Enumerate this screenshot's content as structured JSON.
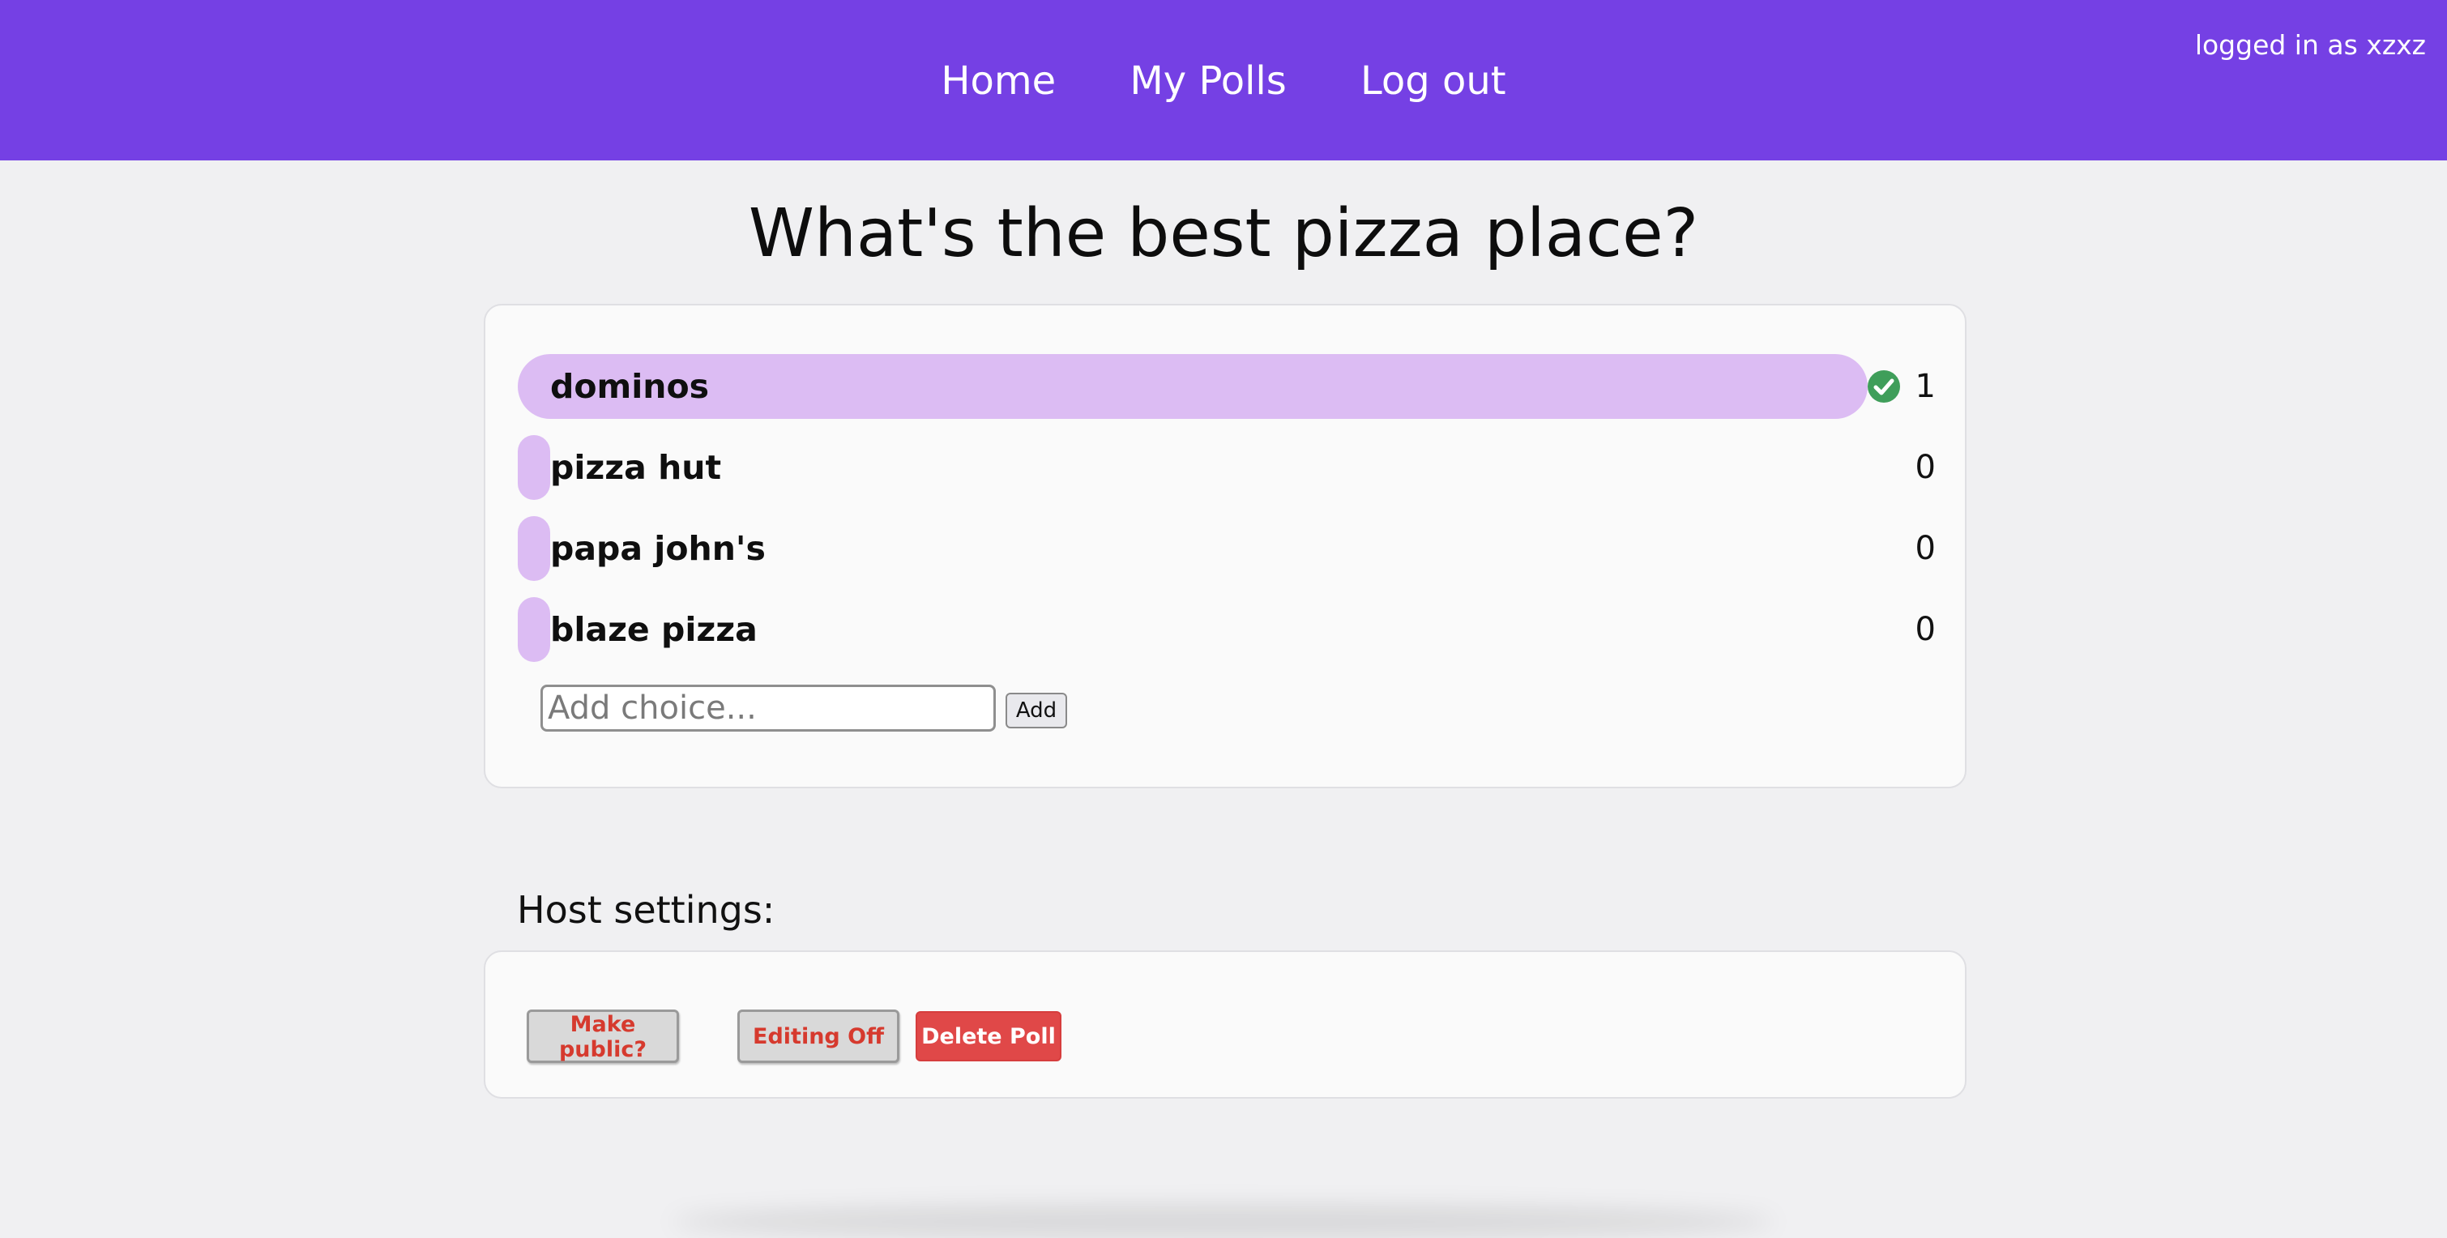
{
  "header": {
    "nav": [
      {
        "label": "Home"
      },
      {
        "label": "My Polls"
      },
      {
        "label": "Log out"
      }
    ],
    "user_status": "logged in as xzxz",
    "bg_color": "#7540e4"
  },
  "poll": {
    "title": "What's the best pizza place?",
    "choices": [
      {
        "label": "dominos",
        "votes": "1",
        "share": 1.0,
        "voted": true,
        "icon": "check-circle-icon"
      },
      {
        "label": "pizza hut",
        "votes": "0",
        "share": 0.0,
        "voted": false
      },
      {
        "label": "papa john's",
        "votes": "0",
        "share": 0.0,
        "voted": false
      },
      {
        "label": "blaze pizza",
        "votes": "0",
        "share": 0.0,
        "voted": false
      }
    ],
    "add_choice": {
      "placeholder": "Add choice...",
      "value": "",
      "button_label": "Add"
    },
    "bar_color": "#dcbcf3"
  },
  "host_settings": {
    "heading": "Host settings:",
    "make_public_label": "Make public?",
    "editing_label": "Editing Off",
    "delete_label": "Delete Poll",
    "danger_color": "#e04848"
  }
}
